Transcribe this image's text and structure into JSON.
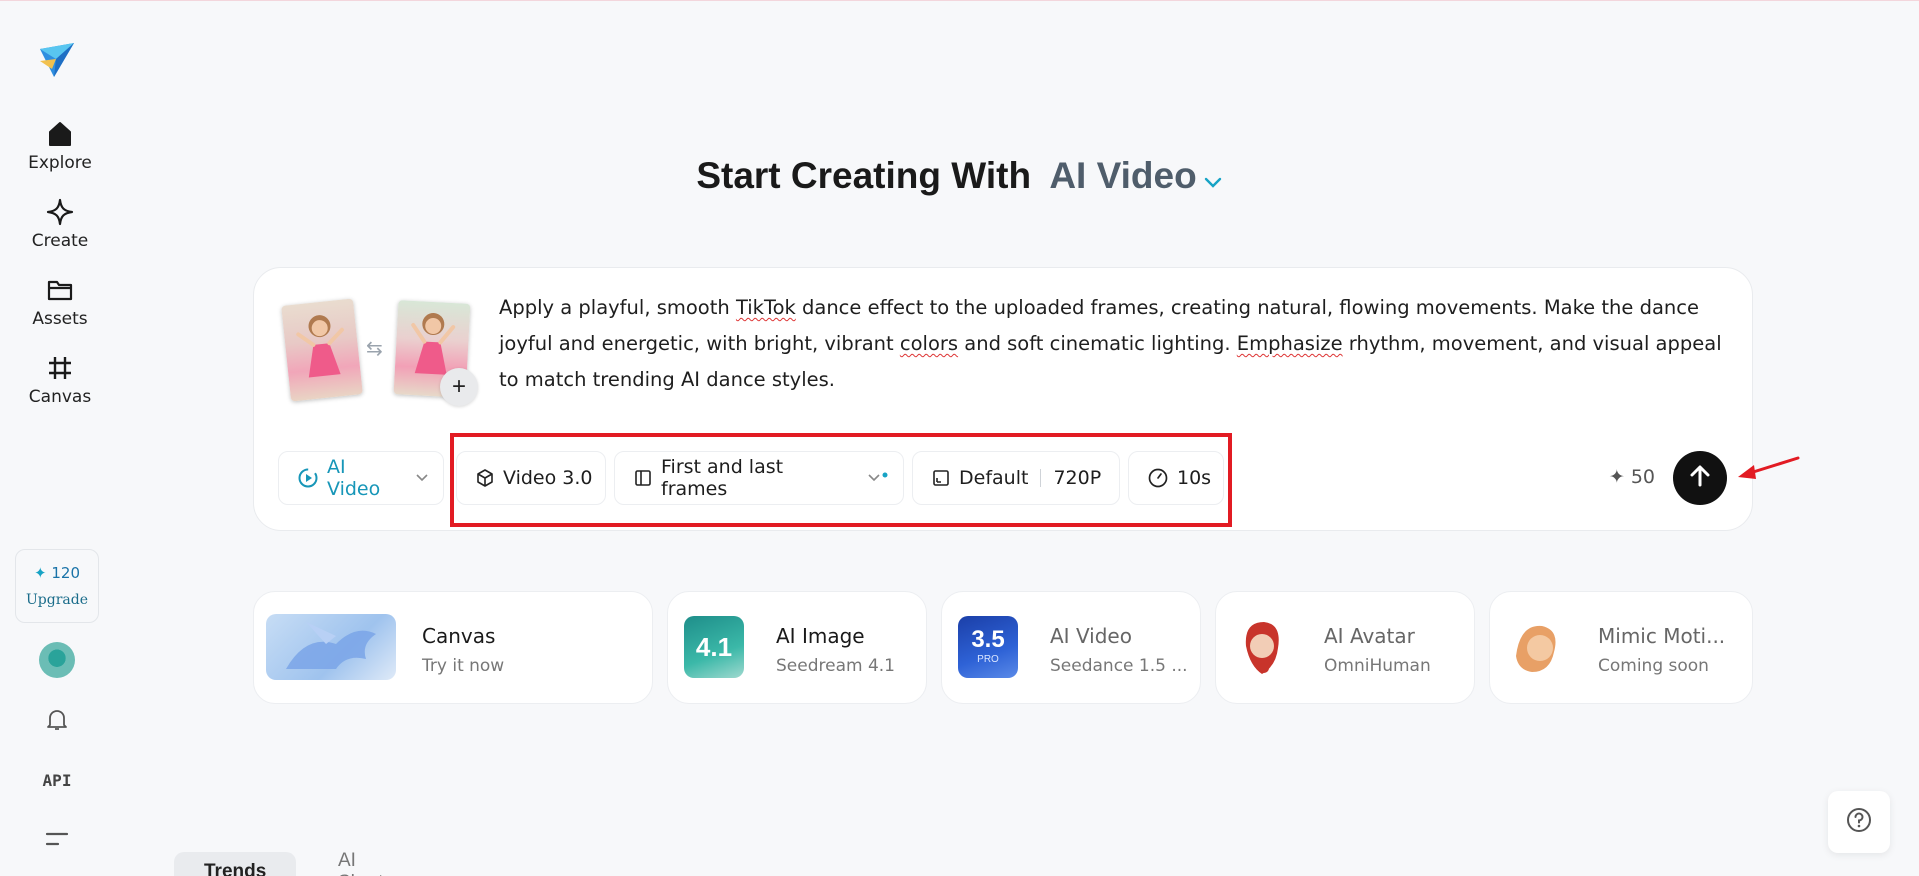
{
  "sidebar": {
    "nav": [
      {
        "label": "Explore",
        "icon": "home-icon"
      },
      {
        "label": "Create",
        "icon": "sparkle-icon"
      },
      {
        "label": "Assets",
        "icon": "folder-icon"
      },
      {
        "label": "Canvas",
        "icon": "frame-icon"
      }
    ],
    "credits": "120",
    "upgrade_label": "Upgrade",
    "api_label": "API"
  },
  "heading": {
    "prefix": "Start Creating With",
    "mode": "AI Video"
  },
  "prompt": {
    "text_parts": [
      "Apply a playful, smooth ",
      "TikTok",
      " dance effect to the uploaded frames, creating natural, flowing movements. Make the dance joyful and energetic, with bright, vibrant ",
      "colors",
      " and soft cinematic lighting. ",
      "Emphasize",
      " rhythm, movement, and visual appeal to match trending AI dance styles."
    ],
    "add_label": "+",
    "swap_symbol": "⇆"
  },
  "toolbar": {
    "mode_label": "AI Video",
    "model_label": "Video 3.0",
    "frames_label": "First and last frames",
    "ratio_label": "Default",
    "resolution_label": "720P",
    "duration_label": "10s",
    "cost": "50"
  },
  "features": [
    {
      "title": "Canvas",
      "subtitle": "Try it now"
    },
    {
      "title": "AI Image",
      "subtitle": "Seedream 4.1",
      "badge": "4.1"
    },
    {
      "title": "AI Video",
      "subtitle": "Seedance 1.5 ...",
      "badge": "3.5",
      "badge_sub": "PRO"
    },
    {
      "title": "AI Avatar",
      "subtitle": "OmniHuman"
    },
    {
      "title": "Mimic Moti...",
      "subtitle": "Coming soon"
    }
  ],
  "bottom_tabs": [
    "Trends",
    "AI Shorts"
  ],
  "colors": {
    "accent": "#1796b8",
    "selection_box": "#e21b23",
    "send_button": "#111111"
  }
}
